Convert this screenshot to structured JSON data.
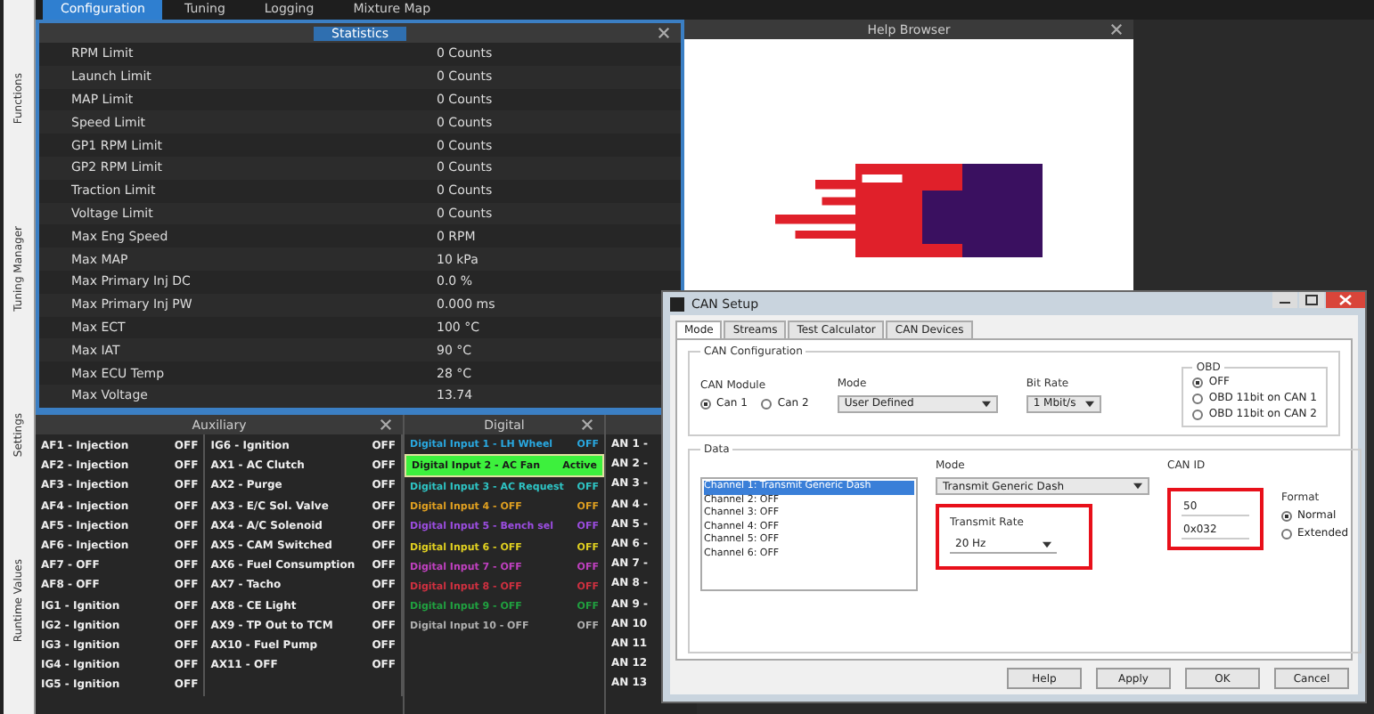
{
  "top_tabs": [
    {
      "label": "Configuration",
      "selected": true
    },
    {
      "label": "Tuning",
      "selected": false
    },
    {
      "label": "Logging",
      "selected": false
    },
    {
      "label": "Mixture Map",
      "selected": false
    }
  ],
  "side_tabs": [
    "Functions",
    "Tuning Manager",
    "Settings",
    "Runtime Values"
  ],
  "statistics": {
    "title": "Statistics",
    "rows": [
      {
        "label": "RPM Limit",
        "value": "0 Counts"
      },
      {
        "label": "Launch Limit",
        "value": "0 Counts"
      },
      {
        "label": "MAP Limit",
        "value": "0 Counts"
      },
      {
        "label": "Speed Limit",
        "value": "0 Counts"
      },
      {
        "label": "GP1 RPM Limit",
        "value": "0 Counts"
      },
      {
        "label": "GP2 RPM Limit",
        "value": "0 Counts"
      },
      {
        "label": "Traction Limit",
        "value": "0 Counts"
      },
      {
        "label": "Voltage Limit",
        "value": "0 Counts"
      },
      {
        "label": "Max Eng Speed",
        "value": "0 RPM"
      },
      {
        "label": "Max MAP",
        "value": "10 kPa"
      },
      {
        "label": "Max Primary Inj DC",
        "value": "0.0 %"
      },
      {
        "label": "Max Primary Inj PW",
        "value": "0.000 ms"
      },
      {
        "label": "Max ECT",
        "value": "100 °C"
      },
      {
        "label": "Max IAT",
        "value": "90 °C"
      },
      {
        "label": "Max ECU Temp",
        "value": "28 °C"
      },
      {
        "label": "Max Voltage",
        "value": "13.74"
      }
    ]
  },
  "help_browser": {
    "title": "Help Browser"
  },
  "auxiliary": {
    "title": "Auxiliary",
    "columns": [
      [
        {
          "label": "AF1 - Injection",
          "value": "OFF"
        },
        {
          "label": "AF2 - Injection",
          "value": "OFF"
        },
        {
          "label": "AF3 - Injection",
          "value": "OFF"
        },
        {
          "label": "AF4 - Injection",
          "value": "OFF"
        },
        {
          "label": "AF5 - Injection",
          "value": "OFF"
        },
        {
          "label": "AF6 - Injection",
          "value": "OFF"
        },
        {
          "label": "AF7 - OFF",
          "value": "OFF"
        },
        {
          "label": "AF8 - OFF",
          "value": "OFF"
        },
        {
          "label": "IG1 - Ignition",
          "value": "OFF"
        },
        {
          "label": "IG2 - Ignition",
          "value": "OFF"
        },
        {
          "label": "IG3 - Ignition",
          "value": "OFF"
        },
        {
          "label": "IG4 - Ignition",
          "value": "OFF"
        },
        {
          "label": "IG5 - Ignition",
          "value": "OFF"
        }
      ],
      [
        {
          "label": "IG6 - Ignition",
          "value": "OFF"
        },
        {
          "label": "AX1 - AC Clutch",
          "value": "OFF"
        },
        {
          "label": "AX2 - Purge",
          "value": "OFF"
        },
        {
          "label": "AX3 - E/C Sol. Valve",
          "value": "OFF"
        },
        {
          "label": "AX4 - A/C Solenoid",
          "value": "OFF"
        },
        {
          "label": "AX5 - CAM Switched",
          "value": "OFF"
        },
        {
          "label": "AX6 - Fuel Consumption",
          "value": "OFF"
        },
        {
          "label": "AX7 - Tacho",
          "value": "OFF"
        },
        {
          "label": "AX8 - CE Light",
          "value": "OFF"
        },
        {
          "label": "AX9 - TP Out to TCM",
          "value": "OFF"
        },
        {
          "label": "AX10 - Fuel Pump",
          "value": "OFF"
        },
        {
          "label": "AX11 - OFF",
          "value": "OFF"
        }
      ]
    ]
  },
  "digital": {
    "title": "Digital",
    "items": [
      {
        "label": "Digital Input 1 - LH Wheel",
        "state": "OFF",
        "color": "#29a8e0",
        "active": false
      },
      {
        "label": "Digital Input 2 - AC Fan",
        "state": "Active",
        "color": "#1a1a1a",
        "active": true
      },
      {
        "label": "Digital Input 3 - AC Request",
        "state": "OFF",
        "color": "#2ec4c4",
        "active": false
      },
      {
        "label": "Digital Input 4 - OFF",
        "state": "OFF",
        "color": "#e0a020",
        "active": false
      },
      {
        "label": "Digital Input 5 - Bench sel",
        "state": "OFF",
        "color": "#9b4de0",
        "active": false
      },
      {
        "label": "Digital Input 6 - OFF",
        "state": "OFF",
        "color": "#e0d020",
        "active": false
      },
      {
        "label": "Digital Input 7 - OFF",
        "state": "OFF",
        "color": "#c040c0",
        "active": false
      },
      {
        "label": "Digital Input 8 - OFF",
        "state": "OFF",
        "color": "#d03040",
        "active": false
      },
      {
        "label": "Digital Input 9 - OFF",
        "state": "OFF",
        "color": "#20a040",
        "active": false
      },
      {
        "label": "Digital Input 10 - OFF",
        "state": "OFF",
        "color": "#b0b0b0",
        "active": false
      }
    ]
  },
  "analog": {
    "items": [
      "AN 1 -",
      "AN 2 -",
      "AN 3 -",
      "AN 4 -",
      "AN 5 -",
      "AN 6 -",
      "AN 7 -",
      "AN 8 -",
      "AN 9 -",
      "AN 10",
      "AN 11",
      "AN 12",
      "AN 13"
    ]
  },
  "can_setup": {
    "title": "CAN Setup",
    "tabs": [
      {
        "label": "Mode",
        "selected": true
      },
      {
        "label": "Streams",
        "selected": false
      },
      {
        "label": "Test Calculator",
        "selected": false
      },
      {
        "label": "CAN Devices",
        "selected": false
      }
    ],
    "config_label": "CAN Configuration",
    "module": {
      "label": "CAN Module",
      "options": [
        {
          "label": "Can 1",
          "selected": true
        },
        {
          "label": "Can 2",
          "selected": false
        }
      ]
    },
    "mode": {
      "label": "Mode",
      "value": "User Defined"
    },
    "bit_rate": {
      "label": "Bit Rate",
      "value": "1 Mbit/s"
    },
    "obd": {
      "label": "OBD",
      "options": [
        {
          "label": "OFF",
          "selected": true
        },
        {
          "label": "OBD 11bit on CAN 1",
          "selected": false
        },
        {
          "label": "OBD 11bit on CAN 2",
          "selected": false
        }
      ]
    },
    "data_label": "Data",
    "channels": [
      {
        "label": "Channel 1: Transmit Generic Dash",
        "selected": true
      },
      {
        "label": "Channel 2: OFF",
        "selected": false
      },
      {
        "label": "Channel 3: OFF",
        "selected": false
      },
      {
        "label": "Channel 4: OFF",
        "selected": false
      },
      {
        "label": "Channel 5: OFF",
        "selected": false
      },
      {
        "label": "Channel 6: OFF",
        "selected": false
      }
    ],
    "channel_mode": {
      "label": "Mode",
      "value": "Transmit Generic Dash"
    },
    "transmit_rate": {
      "label": "Transmit Rate",
      "value": "20 Hz",
      "highlighted": true
    },
    "can_id": {
      "label": "CAN ID",
      "values": [
        "50",
        "0x032"
      ],
      "highlighted": true
    },
    "format": {
      "label": "Format",
      "options": [
        {
          "label": "Normal",
          "selected": true
        },
        {
          "label": "Extended",
          "selected": false
        }
      ]
    },
    "buttons": [
      "Help",
      "Apply",
      "OK",
      "Cancel"
    ]
  }
}
